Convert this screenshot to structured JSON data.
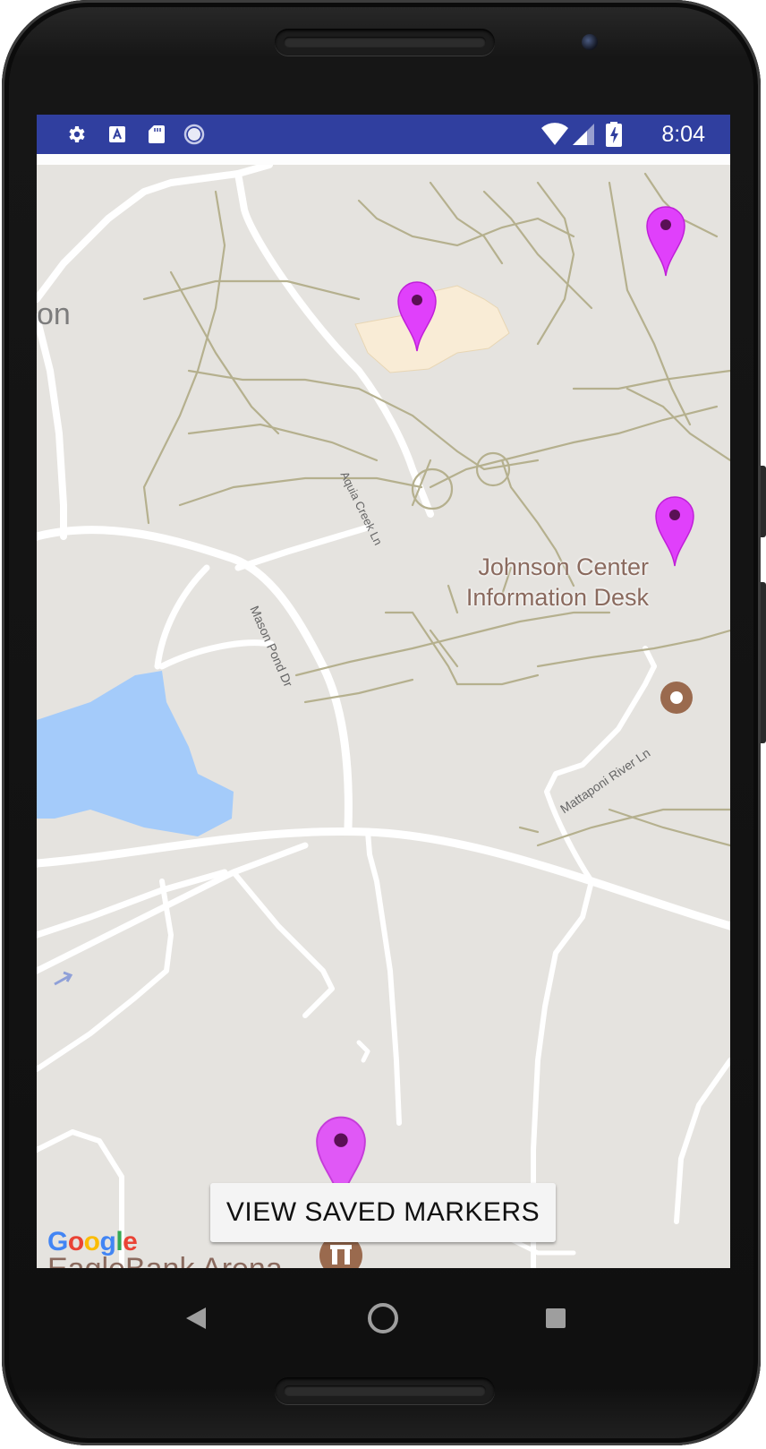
{
  "status_bar": {
    "time": "8:04",
    "left_icons": [
      "gear-icon",
      "text-input-icon",
      "sd-card-icon",
      "loading-icon"
    ],
    "right_icons": [
      "wifi-icon",
      "cell-signal-icon",
      "battery-charging-icon"
    ],
    "background_color": "#303f9f"
  },
  "map": {
    "poi": {
      "johnson_center": "Johnson Center\nInformation Desk",
      "eaglebank_arena": "EagleBank Arena"
    },
    "street_labels": {
      "aquia_creek": "Aquia Creek Ln",
      "mason_pond": "Mason Pond Dr",
      "mattaponi_river": "Mattaponi River Ln"
    },
    "edge_text": "on",
    "google_logo": [
      "G",
      "o",
      "o",
      "g",
      "l",
      "e"
    ],
    "google_colors": [
      "#4285f4",
      "#ea4335",
      "#fbbc05",
      "#4285f4",
      "#34a853",
      "#ea4335"
    ],
    "marker_color": "#e040fb",
    "water_color": "#a4cbfa",
    "building_color": "#f9ecd6"
  },
  "view_saved_markers_button": "VIEW SAVED MARKERS",
  "nav_bar": {
    "back": "back-icon",
    "home": "home-icon",
    "recents": "recents-icon"
  }
}
